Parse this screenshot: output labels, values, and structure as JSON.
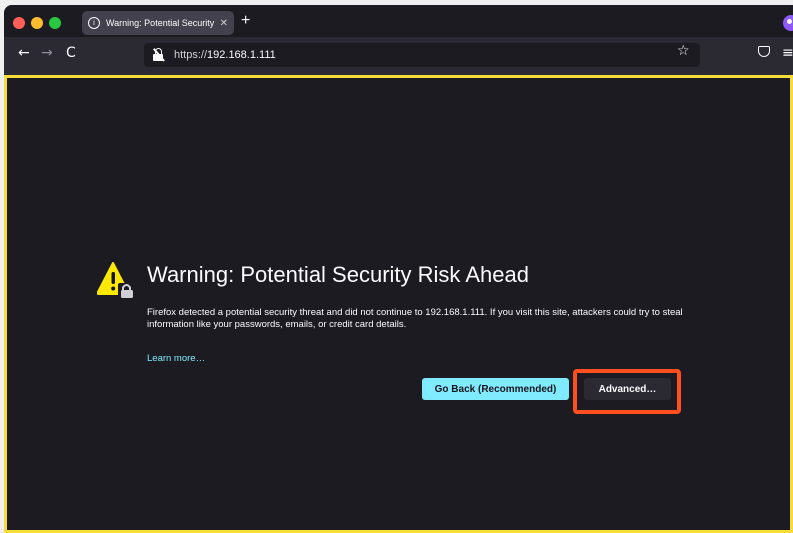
{
  "browser": {
    "tab": {
      "title": "Warning: Potential Security Risk Ahead",
      "info_glyph": "i",
      "close_glyph": "✕"
    },
    "new_tab_glyph": "+",
    "nav": {
      "back_glyph": "←",
      "forward_glyph": "→",
      "reload_glyph": "C"
    },
    "url": {
      "scheme": "https://",
      "host": "192.168.1.111"
    },
    "bookmark_glyph": "☆",
    "menu_glyph": "≡"
  },
  "page": {
    "heading": "Warning: Potential Security Risk Ahead",
    "description": "Firefox detected a potential security threat and did not continue to 192.168.1.111. If you visit this site, attackers could try to steal information like your passwords, emails, or credit card details.",
    "learn_more": "Learn more…",
    "go_back_label": "Go Back (Recommended)",
    "advanced_label": "Advanced…"
  },
  "colors": {
    "content_border": "#f5dc38",
    "highlight_box": "#ff4f1f",
    "primary_button": "#80ebff",
    "warning_icon": "#ffe900"
  },
  "icons": [
    "close-window",
    "minimize-window",
    "zoom-window",
    "info-icon",
    "insecure-lock-icon",
    "bookmark-star-icon",
    "pocket-icon",
    "hamburger-menu-icon",
    "warning-lock-icon"
  ]
}
